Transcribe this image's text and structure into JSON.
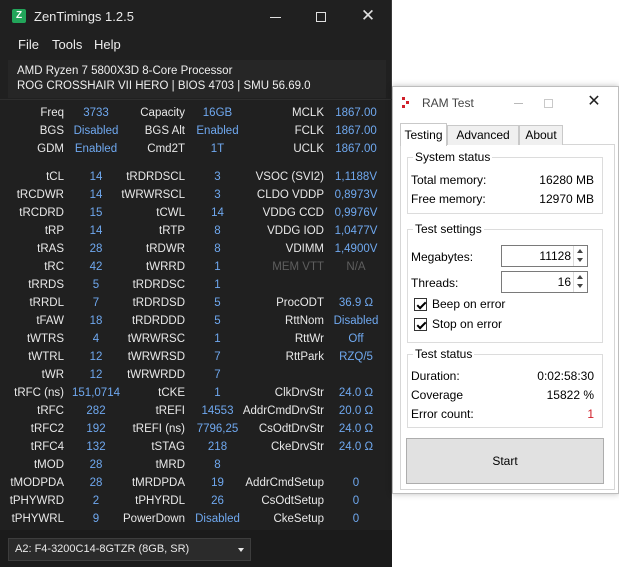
{
  "zen": {
    "title": "ZenTimings 1.2.5",
    "icon_letter": "Z",
    "menu": [
      "File",
      "Tools",
      "Help"
    ],
    "cpu": "AMD Ryzen 7 5800X3D 8-Core Processor",
    "board": "ROG CROSSHAIR VII HERO | BIOS 4703 | SMU 56.69.0",
    "summary": [
      {
        "l1": "Freq",
        "v1": "3733",
        "l2": "Capacity",
        "v2": "16GB",
        "l3": "MCLK",
        "v3": "1867.00"
      },
      {
        "l1": "BGS",
        "v1": "Disabled",
        "l2": "BGS Alt",
        "v2": "Enabled",
        "l3": "FCLK",
        "v3": "1867.00"
      },
      {
        "l1": "GDM",
        "v1": "Enabled",
        "l2": "Cmd2T",
        "v2": "1T",
        "l3": "UCLK",
        "v3": "1867.00"
      }
    ],
    "timings": [
      {
        "l1": "tCL",
        "v1": "14",
        "l2": "tRDRDSCL",
        "v2": "3",
        "l3": "VSOC (SVI2)",
        "v3": "1,1188V"
      },
      {
        "l1": "tRCDWR",
        "v1": "14",
        "l2": "tWRWRSCL",
        "v2": "3",
        "l3": "CLDO VDDP",
        "v3": "0,8973V"
      },
      {
        "l1": "tRCDRD",
        "v1": "15",
        "l2": "tCWL",
        "v2": "14",
        "l3": "VDDG CCD",
        "v3": "0,9976V"
      },
      {
        "l1": "tRP",
        "v1": "14",
        "l2": "tRTP",
        "v2": "8",
        "l3": "VDDG IOD",
        "v3": "1,0477V"
      },
      {
        "l1": "tRAS",
        "v1": "28",
        "l2": "tRDWR",
        "v2": "8",
        "l3": "VDIMM",
        "v3": "1,4900V"
      },
      {
        "l1": "tRC",
        "v1": "42",
        "l2": "tWRRD",
        "v2": "1",
        "l3": "MEM VTT",
        "v3": "N/A"
      },
      {
        "l1": "tRRDS",
        "v1": "5",
        "l2": "tRDRDSC",
        "v2": "1",
        "l3": "",
        "v3": ""
      },
      {
        "l1": "tRRDL",
        "v1": "7",
        "l2": "tRDRDSD",
        "v2": "5",
        "l3": "ProcODT",
        "v3": "36.9 Ω"
      },
      {
        "l1": "tFAW",
        "v1": "18",
        "l2": "tRDRDDD",
        "v2": "5",
        "l3": "RttNom",
        "v3": "Disabled"
      },
      {
        "l1": "tWTRS",
        "v1": "4",
        "l2": "tWRWRSC",
        "v2": "1",
        "l3": "RttWr",
        "v3": "Off"
      },
      {
        "l1": "tWTRL",
        "v1": "12",
        "l2": "tWRWRSD",
        "v2": "7",
        "l3": "RttPark",
        "v3": "RZQ/5"
      },
      {
        "l1": "tWR",
        "v1": "12",
        "l2": "tWRWRDD",
        "v2": "7",
        "l3": "",
        "v3": ""
      },
      {
        "l1": "tRFC (ns)",
        "v1": "151,0714",
        "l2": "tCKE",
        "v2": "1",
        "l3": "ClkDrvStr",
        "v3": "24.0 Ω"
      },
      {
        "l1": "tRFC",
        "v1": "282",
        "l2": "tREFI",
        "v2": "14553",
        "l3": "AddrCmdDrvStr",
        "v3": "20.0 Ω"
      },
      {
        "l1": "tRFC2",
        "v1": "192",
        "l2": "tREFI (ns)",
        "v2": "7796,25",
        "l3": "CsOdtDrvStr",
        "v3": "24.0 Ω"
      },
      {
        "l1": "tRFC4",
        "v1": "132",
        "l2": "tSTAG",
        "v2": "218",
        "l3": "CkeDrvStr",
        "v3": "24.0 Ω"
      },
      {
        "l1": "tMOD",
        "v1": "28",
        "l2": "tMRD",
        "v2": "8",
        "l3": "",
        "v3": ""
      },
      {
        "l1": "tMODPDA",
        "v1": "28",
        "l2": "tMRDPDA",
        "v2": "19",
        "l3": "AddrCmdSetup",
        "v3": "0"
      },
      {
        "l1": "tPHYWRD",
        "v1": "2",
        "l2": "tPHYRDL",
        "v2": "26",
        "l3": "CsOdtSetup",
        "v3": "0"
      },
      {
        "l1": "tPHYWRL",
        "v1": "9",
        "l2": "PowerDown",
        "v2": "Disabled",
        "l3": "CkeSetup",
        "v3": "0"
      }
    ],
    "module": "A2: F4-3200C14-8GTZR (8GB, SR)"
  },
  "ram": {
    "title": "RAM Test",
    "tabs": [
      "Testing",
      "Advanced",
      "About"
    ],
    "system_status": {
      "title": "System status",
      "total_label": "Total memory:",
      "total_value": "16280 MB",
      "free_label": "Free memory:",
      "free_value": "12970 MB"
    },
    "test_settings": {
      "title": "Test settings",
      "megabytes_label": "Megabytes:",
      "megabytes_value": "11128",
      "threads_label": "Threads:",
      "threads_value": "16",
      "beep_label": "Beep on error",
      "stop_label": "Stop on error"
    },
    "test_status": {
      "title": "Test status",
      "duration_label": "Duration:",
      "duration_value": "0:02:58:30",
      "coverage_label": "Coverage",
      "coverage_value": "15822 %",
      "errors_label": "Error count:",
      "errors_value": "1"
    },
    "start_label": "Start"
  }
}
